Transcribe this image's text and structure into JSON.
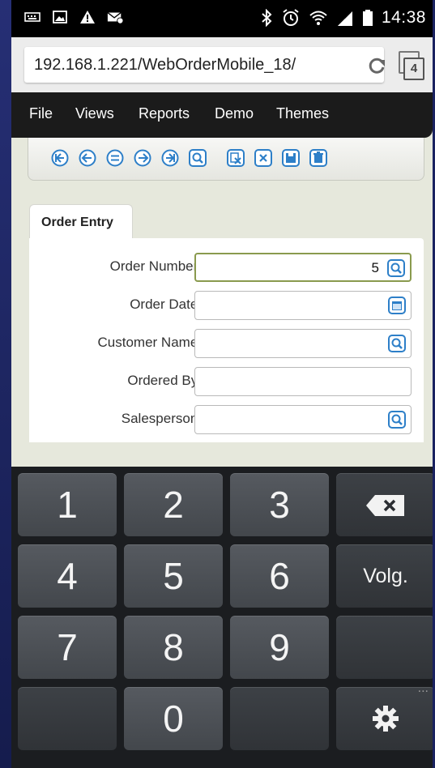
{
  "status_bar": {
    "time": "14:38",
    "left_icons": [
      "keyboard-icon",
      "image-icon",
      "warning-icon",
      "email-icon"
    ],
    "right_icons": [
      "bluetooth-icon",
      "alarm-icon",
      "wifi-icon",
      "signal-icon",
      "battery-icon"
    ]
  },
  "browser": {
    "url": "192.168.1.221/WebOrderMobile_18/",
    "tab_count": "4"
  },
  "menu": {
    "items": [
      "File",
      "Views",
      "Reports",
      "Demo",
      "Themes"
    ]
  },
  "toolbar": {
    "buttons": [
      "first-record",
      "previous-record",
      "find-equal",
      "next-record",
      "last-record",
      "prompt",
      "clear",
      "clear-all",
      "save",
      "delete"
    ]
  },
  "form": {
    "tab_label": "Order Entry",
    "fields": [
      {
        "label": "Order Number:",
        "value": "5",
        "button": "search-icon"
      },
      {
        "label": "Order Date:",
        "value": "",
        "button": "calendar-icon"
      },
      {
        "label": "Customer Name:",
        "value": "",
        "button": "search-icon"
      },
      {
        "label": "Ordered By:",
        "value": "",
        "button": ""
      },
      {
        "label": "Salesperson:",
        "value": "",
        "button": "search-icon"
      }
    ]
  },
  "keyboard": {
    "keys": {
      "k1": "1",
      "k2": "2",
      "k3": "3",
      "k4": "4",
      "k5": "5",
      "k6": "6",
      "k7": "7",
      "k8": "8",
      "k9": "9",
      "k0": "0",
      "next": "Volg."
    },
    "more_indicator": "..."
  },
  "colors": {
    "page_background": "#e6e8dc",
    "menu_background": "#1b1b1b",
    "toolbar_icon": "#2d7fc8",
    "active_field_border": "#8a9a4e",
    "keyboard_background": "#1b1d20"
  }
}
